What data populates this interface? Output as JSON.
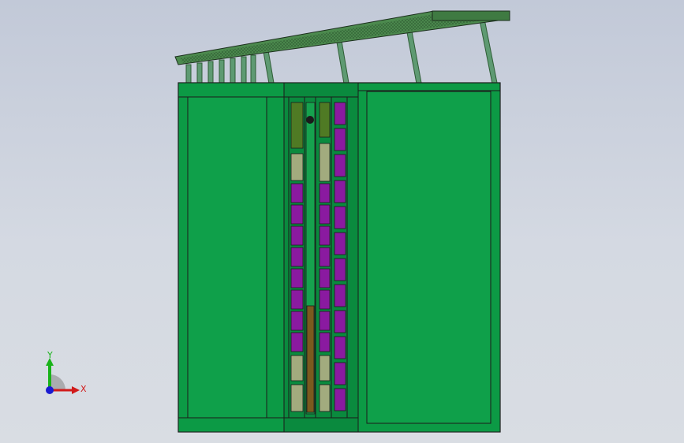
{
  "viewport": {
    "background_top": "#c2c9d8",
    "background_bottom": "#d9dde3"
  },
  "model": {
    "body_color": "#0c9a45",
    "panel_color": "#0fa04a",
    "edge_color": "#1b1b1b",
    "roof_color": "#4c8a4e",
    "post_color": "#5e9a72",
    "module_purple": "#8a1aa0",
    "module_olive": "#a2ab7e",
    "module_darkgreen": "#4f7a24",
    "module_brown": "#7a5a1e"
  },
  "triad": {
    "x_label": "X",
    "y_label": "Y",
    "x_color": "#d11a1a",
    "y_color": "#19b319",
    "z_color": "#1a1ad1"
  }
}
